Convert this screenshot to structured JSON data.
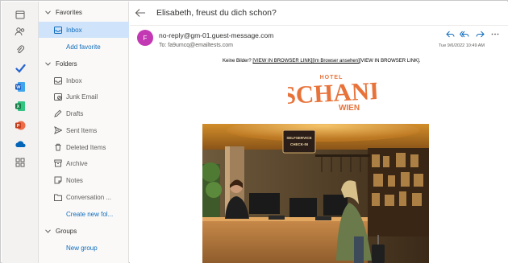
{
  "rail": {
    "items": [
      "calendar-icon",
      "people-icon",
      "attach-icon",
      "todo-check-icon",
      "word-icon",
      "excel-icon",
      "powerpoint-icon",
      "onedrive-icon",
      "apps-icon"
    ]
  },
  "folders": {
    "favorites_label": "Favorites",
    "favorites": [
      {
        "label": "Inbox",
        "selected": true
      }
    ],
    "add_favorite": "Add favorite",
    "folders_label": "Folders",
    "items": [
      {
        "label": "Inbox"
      },
      {
        "label": "Junk Email"
      },
      {
        "label": "Drafts"
      },
      {
        "label": "Sent Items"
      },
      {
        "label": "Deleted Items"
      },
      {
        "label": "Archive"
      },
      {
        "label": "Notes"
      },
      {
        "label": "Conversation ..."
      }
    ],
    "create_new_folder": "Create new fol...",
    "groups_label": "Groups",
    "new_group": "New group"
  },
  "message": {
    "subject": "Elisabeth, freust du dich schon?",
    "avatar_letter": "F",
    "sender": "no-reply@gm-01.guest-message.com",
    "to_prefix": "To:",
    "to_address": "fa9umcq@emailtests.com",
    "date": "Tue 9/6/2022 10:49 AM",
    "browser_prefix": "Keine Bilder?",
    "browser_link": "[VIEW IN BROWSER LINK]",
    "browser_link_de": "[Im Browser ansehen]",
    "browser_suffix": "[VIEW IN BROWSER LINK]."
  },
  "logo": {
    "top": "HOTEL",
    "main": "SCHANI",
    "bottom": "WIEN"
  },
  "hero": {
    "sign_line1": "SELFSERVICE",
    "sign_line2": "CHECK-IN"
  },
  "colors": {
    "accent": "#0f6cbd",
    "selected_bg": "#cfe4fa",
    "avatar": "#c239b3",
    "logo_orange": "#e8733a"
  }
}
